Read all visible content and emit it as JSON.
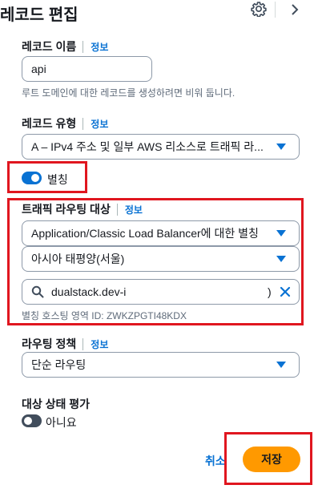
{
  "header": {
    "title": "레코드 편집"
  },
  "record_name": {
    "label": "레코드 이름",
    "info": "정보",
    "value": "api",
    "hint": "루트 도메인에 대한 레코드를 생성하려면 비워 둡니다."
  },
  "record_type": {
    "label": "레코드 유형",
    "info": "정보",
    "value": "A – IPv4 주소 및 일부 AWS 리소스로 트래픽 라..."
  },
  "alias": {
    "label": "별칭",
    "enabled": true
  },
  "traffic_target": {
    "label": "트래픽 라우팅 대상",
    "info": "정보",
    "endpoint": "Application/Classic Load Balancer에 대한 별칭",
    "region": "아시아 태평양(서울)",
    "search_value": "dualstack.dev-i",
    "search_suffix": ")",
    "hosted_zone": "별칭 호스팅 영역 ID: ZWKZPGTI48KDX"
  },
  "routing_policy": {
    "label": "라우팅 정책",
    "info": "정보",
    "value": "단순 라우팅"
  },
  "health_check": {
    "label": "대상 상태 평가",
    "toggle_label": "아니요",
    "enabled": false
  },
  "footer": {
    "cancel": "취소",
    "save": "저장"
  },
  "colors": {
    "accent": "#0972d3",
    "primary_button": "#ff9900",
    "highlight_border": "#e0161f",
    "toggle_off": "#414d5c"
  }
}
